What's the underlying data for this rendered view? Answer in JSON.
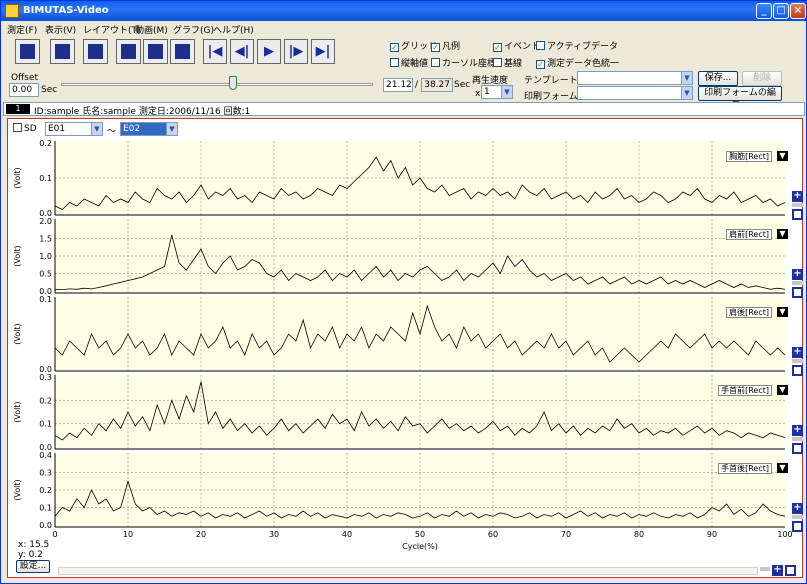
{
  "window": {
    "title": "BIMUTAS-Video"
  },
  "menu": [
    "測定(F)",
    "表示(V)",
    "レイアウト(T)",
    "動画(M)",
    "グラフ(G)",
    "ヘルプ(H)"
  ],
  "toolbar": {
    "tools": [
      "open-file-icon",
      "folder-icon",
      "print-icon",
      "edit-icon",
      "graph-icon",
      "grid-graph-icon"
    ],
    "nav": [
      "first-icon",
      "prev-icon",
      "play-icon",
      "next-icon",
      "last-icon"
    ]
  },
  "options": {
    "grid": "グリッド",
    "legend": "凡例",
    "event": "イベント",
    "active_data": "アクティブデータ",
    "vertical_value": "縦軸値",
    "cursor_coord": "カーソル座標",
    "baseline": "基線",
    "unify_color": "測定データ色統一"
  },
  "offset": {
    "label": "Offset",
    "value": "0.00",
    "unit": "Sec"
  },
  "time": {
    "current": "21.12",
    "sep": "/",
    "total": "38.27",
    "unit": "Sec"
  },
  "playback": {
    "label": "再生速度",
    "prefix": "x",
    "value": "1"
  },
  "slider": {
    "position": 0.55
  },
  "template": {
    "label": "テンプレート:",
    "save": "保存...",
    "delete": "削除"
  },
  "printform": {
    "label": "印刷フォーム:",
    "edit": "印刷フォームの編集..."
  },
  "info": {
    "number": "1",
    "text": "ID:sample 氏名:sample 測定日:2006/11/16 回数:1"
  },
  "selector": {
    "sd": "SD",
    "from": "E01",
    "tilde": "〜",
    "to": "E02"
  },
  "cursor_readout": {
    "x_label": "x:",
    "x_value": "15.5",
    "y_label": "y:",
    "y_value": "0.2",
    "settings": "設定..."
  },
  "chart_data": {
    "type": "line",
    "xlabel": "Cycle(%)",
    "xlim": [
      0,
      100
    ],
    "xticks": [
      0,
      10,
      20,
      30,
      40,
      50,
      60,
      70,
      80,
      90,
      100
    ],
    "grid": true,
    "panels": [
      {
        "name": "胸筋[Rect]",
        "ylabel": "(Volt)",
        "ylim": [
          0,
          0.2
        ],
        "yticks": [
          "0.0",
          "0.1",
          "0.2"
        ],
        "values": [
          0.02,
          0.01,
          0.03,
          0.02,
          0.04,
          0.03,
          0.02,
          0.05,
          0.03,
          0.04,
          0.03,
          0.06,
          0.04,
          0.03,
          0.07,
          0.05,
          0.04,
          0.06,
          0.03,
          0.05,
          0.08,
          0.04,
          0.06,
          0.05,
          0.07,
          0.04,
          0.05,
          0.03,
          0.06,
          0.05,
          0.04,
          0.07,
          0.05,
          0.06,
          0.04,
          0.05,
          0.07,
          0.06,
          0.05,
          0.08,
          0.07,
          0.09,
          0.11,
          0.13,
          0.16,
          0.12,
          0.15,
          0.1,
          0.13,
          0.08,
          0.1,
          0.07,
          0.06,
          0.08,
          0.05,
          0.06,
          0.07,
          0.04,
          0.06,
          0.05,
          0.07,
          0.05,
          0.06,
          0.04,
          0.08,
          0.06,
          0.05,
          0.07,
          0.04,
          0.05,
          0.06,
          0.04,
          0.05,
          0.03,
          0.06,
          0.04,
          0.05,
          0.07,
          0.04,
          0.05,
          0.03,
          0.04,
          0.06,
          0.05,
          0.03,
          0.04,
          0.06,
          0.05,
          0.07,
          0.04,
          0.03,
          0.05,
          0.04,
          0.06,
          0.03,
          0.04,
          0.05,
          0.03,
          0.04,
          0.02,
          0.03
        ]
      },
      {
        "name": "肩前[Rect]",
        "ylabel": "(Volt)",
        "ylim": [
          0,
          2.0
        ],
        "yticks": [
          "0.0",
          "0.5",
          "1.0",
          "1.5",
          "2.0"
        ],
        "values": [
          0.05,
          0.04,
          0.06,
          0.05,
          0.08,
          0.06,
          0.1,
          0.15,
          0.2,
          0.25,
          0.3,
          0.35,
          0.4,
          0.5,
          0.6,
          0.7,
          1.6,
          0.8,
          0.6,
          0.9,
          1.2,
          0.7,
          0.5,
          0.8,
          1.0,
          0.6,
          0.7,
          0.9,
          0.8,
          0.5,
          0.4,
          0.6,
          0.3,
          0.5,
          0.4,
          0.3,
          0.4,
          0.6,
          0.3,
          0.5,
          0.4,
          0.6,
          0.3,
          0.5,
          0.7,
          0.4,
          0.6,
          0.3,
          0.5,
          0.4,
          0.6,
          0.7,
          0.5,
          0.3,
          0.4,
          0.6,
          0.3,
          0.5,
          0.4,
          0.6,
          0.8,
          0.5,
          1.0,
          0.7,
          0.9,
          0.6,
          0.4,
          0.5,
          0.3,
          0.4,
          0.5,
          0.3,
          0.4,
          0.2,
          0.3,
          0.4,
          0.2,
          0.3,
          0.4,
          0.2,
          0.3,
          0.2,
          0.3,
          0.4,
          0.2,
          0.3,
          0.2,
          0.3,
          0.2,
          0.1,
          0.2,
          0.3,
          0.2,
          0.1,
          0.2,
          0.1,
          0.15,
          0.1,
          0.05,
          0.08,
          0.05
        ]
      },
      {
        "name": "肩後[Rect]",
        "ylabel": "(Volt)",
        "ylim": [
          0,
          0.1
        ],
        "yticks": [
          "0.0",
          "0.1"
        ],
        "values": [
          0.03,
          0.02,
          0.04,
          0.03,
          0.02,
          0.05,
          0.03,
          0.04,
          0.02,
          0.03,
          0.05,
          0.03,
          0.04,
          0.02,
          0.03,
          0.05,
          0.02,
          0.04,
          0.03,
          0.02,
          0.05,
          0.03,
          0.04,
          0.06,
          0.03,
          0.04,
          0.02,
          0.05,
          0.03,
          0.04,
          0.02,
          0.03,
          0.05,
          0.04,
          0.07,
          0.03,
          0.05,
          0.04,
          0.06,
          0.03,
          0.05,
          0.04,
          0.06,
          0.03,
          0.05,
          0.04,
          0.06,
          0.05,
          0.04,
          0.08,
          0.05,
          0.09,
          0.06,
          0.04,
          0.05,
          0.03,
          0.06,
          0.04,
          0.05,
          0.03,
          0.04,
          0.05,
          0.03,
          0.04,
          0.02,
          0.03,
          0.04,
          0.03,
          0.05,
          0.03,
          0.04,
          0.02,
          0.03,
          0.04,
          0.02,
          0.03,
          0.01,
          0.02,
          0.03,
          0.02,
          0.01,
          0.02,
          0.03,
          0.04,
          0.03,
          0.05,
          0.04,
          0.03,
          0.04,
          0.05,
          0.03,
          0.04,
          0.03,
          0.04,
          0.03,
          0.02,
          0.04,
          0.03,
          0.02,
          0.03,
          0.02
        ]
      },
      {
        "name": "手首前[Rect]",
        "ylabel": "(Volt)",
        "ylim": [
          0,
          0.3
        ],
        "yticks": [
          "0.0",
          "0.1",
          "0.2",
          "0.3"
        ],
        "values": [
          0.05,
          0.03,
          0.06,
          0.04,
          0.08,
          0.05,
          0.1,
          0.07,
          0.12,
          0.08,
          0.15,
          0.09,
          0.13,
          0.07,
          0.18,
          0.1,
          0.2,
          0.12,
          0.22,
          0.15,
          0.28,
          0.1,
          0.15,
          0.08,
          0.12,
          0.07,
          0.1,
          0.06,
          0.09,
          0.05,
          0.08,
          0.12,
          0.07,
          0.1,
          0.06,
          0.09,
          0.12,
          0.08,
          0.14,
          0.1,
          0.12,
          0.07,
          0.15,
          0.09,
          0.12,
          0.08,
          0.11,
          0.07,
          0.13,
          0.09,
          0.1,
          0.06,
          0.09,
          0.12,
          0.08,
          0.1,
          0.07,
          0.09,
          0.06,
          0.08,
          0.11,
          0.07,
          0.09,
          0.05,
          0.08,
          0.06,
          0.09,
          0.15,
          0.07,
          0.1,
          0.06,
          0.09,
          0.05,
          0.08,
          0.06,
          0.09,
          0.07,
          0.12,
          0.08,
          0.1,
          0.06,
          0.08,
          0.05,
          0.07,
          0.06,
          0.08,
          0.05,
          0.07,
          0.09,
          0.06,
          0.08,
          0.05,
          0.07,
          0.06,
          0.04,
          0.06,
          0.05,
          0.04,
          0.06,
          0.05,
          0.04
        ]
      },
      {
        "name": "手首後[Rect]",
        "ylabel": "(Volt)",
        "ylim": [
          0,
          0.4
        ],
        "yticks": [
          "0.0",
          "0.1",
          "0.2",
          "0.3",
          "0.4"
        ],
        "values": [
          0.05,
          0.1,
          0.08,
          0.15,
          0.1,
          0.2,
          0.12,
          0.15,
          0.08,
          0.1,
          0.25,
          0.12,
          0.08,
          0.1,
          0.06,
          0.08,
          0.05,
          0.07,
          0.06,
          0.08,
          0.05,
          0.07,
          0.04,
          0.06,
          0.05,
          0.07,
          0.04,
          0.06,
          0.08,
          0.05,
          0.07,
          0.04,
          0.06,
          0.05,
          0.08,
          0.05,
          0.07,
          0.04,
          0.06,
          0.05,
          0.04,
          0.06,
          0.05,
          0.07,
          0.04,
          0.06,
          0.05,
          0.07,
          0.06,
          0.04,
          0.05,
          0.07,
          0.04,
          0.06,
          0.05,
          0.08,
          0.05,
          0.07,
          0.04,
          0.06,
          0.05,
          0.07,
          0.06,
          0.04,
          0.05,
          0.07,
          0.04,
          0.06,
          0.05,
          0.07,
          0.04,
          0.06,
          0.08,
          0.05,
          0.07,
          0.04,
          0.06,
          0.05,
          0.07,
          0.04,
          0.06,
          0.05,
          0.07,
          0.05,
          0.04,
          0.06,
          0.05,
          0.07,
          0.04,
          0.06,
          0.1,
          0.08,
          0.12,
          0.06,
          0.09,
          0.05,
          0.07,
          0.12,
          0.08,
          0.06,
          0.05
        ]
      }
    ]
  }
}
